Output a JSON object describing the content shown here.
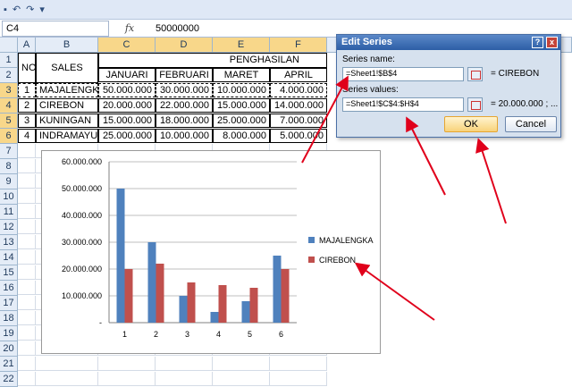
{
  "namebox": "C4",
  "fx": "fx",
  "formula": "50000000",
  "columns": [
    "A",
    "B",
    "C",
    "D",
    "E",
    "F"
  ],
  "rows": [
    "1",
    "2",
    "3",
    "4",
    "5",
    "6",
    "7",
    "8",
    "9",
    "10",
    "11",
    "12",
    "13",
    "14",
    "15",
    "16",
    "17",
    "18",
    "19",
    "20",
    "21",
    "22"
  ],
  "headers": {
    "no": "NO",
    "sales": "SALES",
    "penghasilan": "PENGHASILAN"
  },
  "months": [
    "JANUARI",
    "FEBRUARI",
    "MARET",
    "APRIL"
  ],
  "table": [
    {
      "no": "1",
      "sales": "MAJALENGKA",
      "v": [
        "50.000.000",
        "30.000.000",
        "10.000.000",
        "4.000.000"
      ]
    },
    {
      "no": "2",
      "sales": "CIREBON",
      "v": [
        "20.000.000",
        "22.000.000",
        "15.000.000",
        "14.000.000"
      ]
    },
    {
      "no": "3",
      "sales": "KUNINGAN",
      "v": [
        "15.000.000",
        "18.000.000",
        "25.000.000",
        "7.000.000"
      ]
    },
    {
      "no": "4",
      "sales": "INDRAMAYU",
      "v": [
        "25.000.000",
        "10.000.000",
        "8.000.000",
        "5.000.000"
      ]
    }
  ],
  "dialog": {
    "title": "Edit Series",
    "help": "?",
    "close": "x",
    "name_label": "Series name:",
    "name_value": "=Sheet1!$B$4",
    "name_result": "= CIREBON",
    "values_label": "Series values:",
    "values_value": "=Sheet1!$C$4:$H$4",
    "values_result": "= 20.000.000 ; ...",
    "ok": "OK",
    "cancel": "Cancel"
  },
  "colors": {
    "series1": "#4f81bd",
    "series2": "#c0504d",
    "arrow": "#e0001b"
  },
  "chart_data": {
    "type": "bar",
    "categories": [
      "1",
      "2",
      "3",
      "4",
      "5",
      "6"
    ],
    "series": [
      {
        "name": "MAJALENGKA",
        "values": [
          50000000,
          30000000,
          10000000,
          4000000,
          8000000,
          25000000
        ]
      },
      {
        "name": "CIREBON",
        "values": [
          20000000,
          22000000,
          15000000,
          14000000,
          13000000,
          20000000
        ]
      }
    ],
    "ylim": [
      0,
      60000000
    ],
    "yticks": [
      "60.000.000",
      "50.000.000",
      "40.000.000",
      "30.000.000",
      "20.000.000",
      "10.000.000",
      "-"
    ],
    "grid": true,
    "legend": "right"
  }
}
